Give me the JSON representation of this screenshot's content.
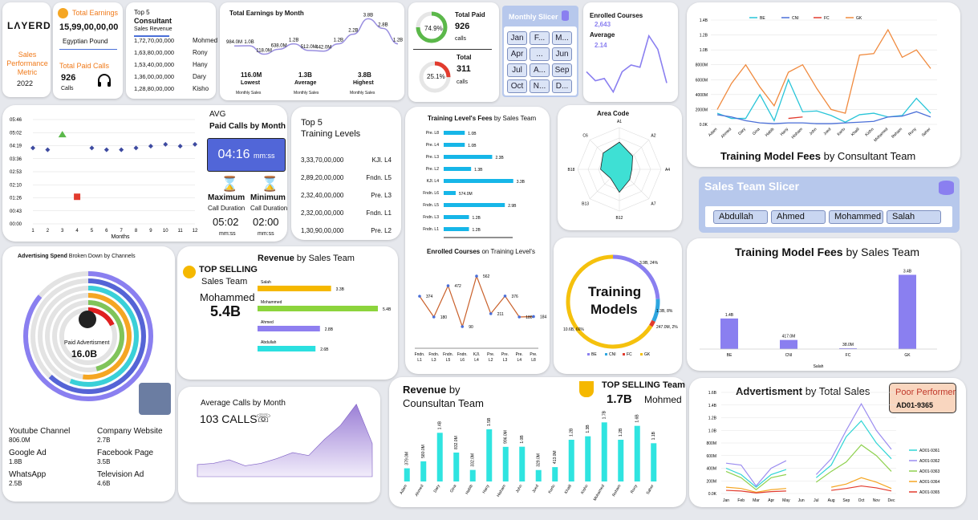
{
  "brand": {
    "logo": "LΛYERD",
    "title": "Sales Performance Metric",
    "year": "2022"
  },
  "earnings": {
    "label": "Total Earnings",
    "value": "15,99,00,00,00",
    "unit": "Egyptian Pound",
    "calls_label": "Total Paid Calls",
    "calls_value": "926",
    "calls_unit": "Calls"
  },
  "top5": {
    "title_top": "Top 5",
    "title": "Consultant",
    "subtitle": "Sales Revenue",
    "rows": [
      {
        "value": "1,72,70,00,000",
        "name": "Mohmed"
      },
      {
        "value": "1,63,80,00,000",
        "name": "Rony"
      },
      {
        "value": "1,53,40,00,000",
        "name": "Hany"
      },
      {
        "value": "1,36,00,00,000",
        "name": "Dary"
      },
      {
        "value": "1,28,80,00,000",
        "name": "Kisho"
      }
    ]
  },
  "earn_month": {
    "title": "Total Earnings by Month",
    "labels": [
      "984.0M",
      "1.0B",
      "118.0M",
      "638.0M",
      "1.2B",
      "512.0M",
      "442.0M",
      "1.2B",
      "2.2B",
      "3.8B",
      "2.8B",
      "1.2B"
    ],
    "values": [
      0.98,
      1.0,
      0.12,
      0.64,
      1.2,
      0.51,
      0.44,
      1.2,
      2.2,
      3.8,
      2.8,
      1.2
    ],
    "lowest": "116.0M",
    "lowest_label": "Lowest",
    "average": "1.3B",
    "average_label": "Average",
    "highest": "3.8B",
    "highest_label": "Highest",
    "sub": "Monthly Sales"
  },
  "paid": {
    "title": "Total Paid",
    "value": "926",
    "unit": "calls",
    "pct": "74.9%",
    "pct_value": 0.749,
    "total_title": "Total",
    "total_value": "311",
    "total_unit": "calls",
    "total_pct": "25.1%",
    "total_pct_value": 0.251
  },
  "month_slicer": {
    "title": "Monthly Slicer",
    "items": [
      "Jan",
      "F...",
      "M...",
      "Apr",
      "...",
      "Jun",
      "Jul",
      "A...",
      "Sep",
      "Oct",
      "N...",
      "D..."
    ]
  },
  "enrolled": {
    "title": "Enrolled Courses",
    "value": "2,643",
    "avg_label": "Average",
    "avg_value": "2.14",
    "values": [
      60,
      40,
      45,
      15,
      60,
      75,
      70,
      140,
      110,
      35
    ]
  },
  "tm_consultant": {
    "title_bold": "Training Model Fees",
    "title_rest": "by Consultant  Team",
    "legend": [
      {
        "name": "BE",
        "color": "#29c5d8"
      },
      {
        "name": "CNI",
        "color": "#4a6fd8"
      },
      {
        "name": "FC",
        "color": "#e23b2e"
      },
      {
        "name": "GK",
        "color": "#f08a3e"
      }
    ],
    "yticks": [
      "0.0K",
      "2000M",
      "4000M",
      "6000M",
      "8000M",
      "1.0B",
      "1.2B",
      "1.4B"
    ],
    "names": [
      "Adam",
      "Ahmed",
      "Dary",
      "Gina",
      "Habib",
      "Hany",
      "Hisham",
      "John",
      "Joed",
      "Kerlo",
      "Khalil",
      "Kisho",
      "Mohamed",
      "Reham",
      "Rony",
      "Saher"
    ],
    "GK": [
      200,
      550,
      800,
      500,
      250,
      700,
      800,
      480,
      200,
      150,
      930,
      950,
      1270,
      900,
      1000,
      750
    ],
    "BE": [
      150,
      80,
      80,
      400,
      50,
      600,
      170,
      180,
      120,
      30,
      130,
      150,
      100,
      120,
      350,
      150
    ],
    "CNI": [
      130,
      100,
      50,
      20,
      10,
      20,
      20,
      10,
      10,
      20,
      30,
      40,
      100,
      110,
      170,
      100
    ],
    "FC": [
      0,
      0,
      0,
      0,
      0,
      80,
      100,
      0,
      0,
      0,
      0,
      0,
      0,
      0,
      0,
      0
    ]
  },
  "avg_calls": {
    "avg": "AVG",
    "title": "Paid Calls by Month",
    "time": "04:16",
    "time_unit": "mm:ss",
    "max_label": "Maximum",
    "min_label": "Minimum",
    "dur": "Call Duration",
    "max": "05:02",
    "min": "02:00",
    "unit": "mm:ss",
    "yticks": [
      "05:46",
      "05:02",
      "04:19",
      "03:36",
      "02:53",
      "02:10",
      "01:26",
      "00:43",
      "00:00"
    ],
    "xlabel": "Months",
    "values": [
      4.2,
      4.1,
      4.7,
      1.5,
      4.2,
      4.1,
      4.1,
      4.2,
      4.3,
      4.4,
      4.3,
      4.4
    ]
  },
  "top5_levels": {
    "title_top": "Top 5",
    "title": "Training Levels",
    "rows": [
      {
        "value": "3,33,70,00,000",
        "name": "KJl. L4"
      },
      {
        "value": "2,89,20,00,000",
        "name": "Fndn. L5"
      },
      {
        "value": "2,32,40,00,000",
        "name": "Pre. L3"
      },
      {
        "value": "2,32,00,00,000",
        "name": "Fndn. L1"
      },
      {
        "value": "1,30,90,00,000",
        "name": "Pre. L2"
      }
    ]
  },
  "level_fees": {
    "title_bold": "Training Level's Fees",
    "title_rest": "by Sales Team",
    "bars": [
      {
        "name": "Pre. L8",
        "value": 1.0,
        "label": "1.0B"
      },
      {
        "name": "Pre. L4",
        "value": 1.0,
        "label": "1.0B"
      },
      {
        "name": "Pre. L3",
        "value": 2.3,
        "label": "2.3B"
      },
      {
        "name": "Pre. L2",
        "value": 1.3,
        "label": "1.3B"
      },
      {
        "name": "KJl. L4",
        "value": 3.3,
        "label": "3.3B"
      },
      {
        "name": "Fndn. L6",
        "value": 0.57,
        "label": "574.0M"
      },
      {
        "name": "Fndn. L5",
        "value": 2.9,
        "label": "2.9B"
      },
      {
        "name": "Fndn. L3",
        "value": 1.2,
        "label": "1.2B"
      },
      {
        "name": "Fndn. L1",
        "value": 1.2,
        "label": "1.2B"
      }
    ]
  },
  "enrolled_levels": {
    "title_bold": "Enrolled Courses",
    "title_rest": "on Training Level's",
    "names": [
      "Fndn. L1",
      "Fndn. L3",
      "Fndn. L5",
      "Fndn. L6",
      "KJl. L4",
      "Pre. L2",
      "Pre. L3",
      "Pre. L4",
      "Pre. L8"
    ],
    "values": [
      374,
      180,
      472,
      90,
      562,
      211,
      376,
      180,
      184
    ]
  },
  "area_code": {
    "title": "Area Code",
    "axes": [
      "A1",
      "A2",
      "A4",
      "A7",
      "B12",
      "B13",
      "B18",
      "C6"
    ],
    "values": [
      0.65,
      0.45,
      0.3,
      0.35,
      0.55,
      0.3,
      0.45,
      0.55
    ]
  },
  "sales_slicer": {
    "title": "Sales Team Slicer",
    "items": [
      "Abdullah",
      "Ahmed",
      "Mohammed",
      "Salah"
    ]
  },
  "adv_channels": {
    "title_bold": "Advertising Spend",
    "title_rest": "Broken Down by Channels",
    "center_label": "Paid Advertisment",
    "center_value": "16.0B",
    "items": [
      {
        "name": "Youtube Channel",
        "value": "806.0M"
      },
      {
        "name": "Company Website",
        "value": "2.7B"
      },
      {
        "name": "Google Ad",
        "value": "1.8B"
      },
      {
        "name": "Facebook Page",
        "value": "3.5B"
      },
      {
        "name": "WhatsApp",
        "value": "2.5B"
      },
      {
        "name": "Television Ad",
        "value": "4.6B"
      }
    ],
    "rings": [
      {
        "color": "#8a7ff0",
        "frac": 0.86
      },
      {
        "color": "#5564d6",
        "frac": 0.62
      },
      {
        "color": "#3ad0d8",
        "frac": 0.56
      },
      {
        "color": "#f5a623",
        "frac": 0.52
      },
      {
        "color": "#80c45a",
        "frac": 0.46
      },
      {
        "color": "#e02020",
        "frac": 0.18
      }
    ]
  },
  "revenue_team": {
    "top_label": "TOP SELLING",
    "top_sub": "Sales Team",
    "person": "Mohammed",
    "value": "5.4B",
    "title_bold": "Revenue",
    "title_rest": "by Sales Team",
    "bars": [
      {
        "name": "Salah",
        "value": 3.3,
        "label": "3.3B",
        "color": "#f5b800"
      },
      {
        "name": "Mohammed",
        "value": 5.4,
        "label": "5.4B",
        "color": "#8cd43c"
      },
      {
        "name": "Ahmed",
        "value": 2.8,
        "label": "2.8B",
        "color": "#8f7ff0"
      },
      {
        "name": "Abdullah",
        "value": 2.6,
        "label": "2.6B",
        "color": "#2be0e0"
      }
    ]
  },
  "training_models": {
    "title1": "Training",
    "title2": "Models",
    "labels": [
      "3.9B, 24%",
      "1.3B, 8%",
      "247.0M, 2%",
      "10.6B, 66%"
    ],
    "fracs": [
      0.24,
      0.08,
      0.02,
      0.66
    ],
    "legend": [
      "BE",
      "CNI",
      "FC",
      "GK"
    ],
    "colors": [
      "#8a7ff0",
      "#2ea6e0",
      "#e23b2e",
      "#f5c10d"
    ]
  },
  "tm_sales": {
    "title_bold": "Training Model Fees",
    "title_rest": "by Sales Team",
    "bars": [
      {
        "name": "BE",
        "value": 1.4,
        "label": "1.4B"
      },
      {
        "name": "CNI",
        "value": 0.417,
        "label": "417.0M"
      },
      {
        "name": "FC",
        "value": 0.038,
        "label": "38.0M"
      },
      {
        "name": "GK",
        "value": 3.4,
        "label": "3.4B"
      }
    ],
    "group": "Salah"
  },
  "avg_month": {
    "title": "Average Calls by Month",
    "value": "103 CALLS",
    "values": [
      20,
      22,
      28,
      18,
      22,
      30,
      40,
      35,
      62,
      85,
      120,
      55
    ]
  },
  "revenue_consultant": {
    "title1": "Revenue",
    "title2": "by",
    "title3": "Counsultan Team",
    "top_label": "TOP SELLING Team",
    "top_value": "1.7B",
    "top_name": "Mohmed",
    "names": [
      "Adam",
      "Ahmed",
      "Dary",
      "Gina",
      "Habib",
      "Hany",
      "Hisham",
      "John",
      "Joed",
      "Kerlo",
      "Khalil",
      "Kisho",
      "Mohamed",
      "Reham",
      "Rony",
      "Saher"
    ],
    "values": [
      0.379,
      0.58,
      1.4,
      0.832,
      0.332,
      1.5,
      0.996,
      1.0,
      0.329,
      0.413,
      1.2,
      1.3,
      1.7,
      1.2,
      1.6,
      1.1
    ],
    "labels": [
      "379.0M",
      "580.0M",
      "1.4B",
      "832.0M",
      "332.0M",
      "1.5B",
      "996.0M",
      "1.0B",
      "329.0M",
      "413.0M",
      "1.2B",
      "1.3B",
      "1.7B",
      "1.2B",
      "1.6B",
      "1.1B"
    ]
  },
  "adv_total": {
    "title_bold": "Advertisment",
    "title_rest": "by Total Sales",
    "poor_label": "Poor Performer",
    "poor_value": "AD01-9365",
    "yticks": [
      "0.0K",
      "200M",
      "400M",
      "600M",
      "800M",
      "1.0B",
      "1.2B",
      "1.4B",
      "1.6B"
    ],
    "months": [
      "Jan",
      "Feb",
      "Mar",
      "Apr",
      "May",
      "Jun",
      "Jul",
      "Aug",
      "Sep",
      "Oct",
      "Nov",
      "Dec"
    ],
    "series": [
      {
        "name": "AD01-9361",
        "color": "#2fd5d5",
        "values": [
          400,
          300,
          100,
          300,
          380,
          null,
          250,
          450,
          900,
          1150,
          800,
          550
        ]
      },
      {
        "name": "AD01-9362",
        "color": "#9b8cf0",
        "values": [
          480,
          450,
          120,
          400,
          520,
          null,
          300,
          550,
          1000,
          1420,
          1000,
          700
        ]
      },
      {
        "name": "AD01-9363",
        "color": "#8fd14f",
        "values": [
          350,
          250,
          60,
          250,
          300,
          null,
          180,
          350,
          500,
          770,
          600,
          350
        ]
      },
      {
        "name": "AD01-9364",
        "color": "#f5a623",
        "values": [
          100,
          80,
          20,
          60,
          80,
          null,
          null,
          100,
          150,
          250,
          180,
          80
        ]
      },
      {
        "name": "AD01-9365",
        "color": "#e23b2e",
        "values": [
          50,
          40,
          10,
          30,
          40,
          null,
          null,
          50,
          80,
          120,
          90,
          40
        ]
      }
    ]
  }
}
